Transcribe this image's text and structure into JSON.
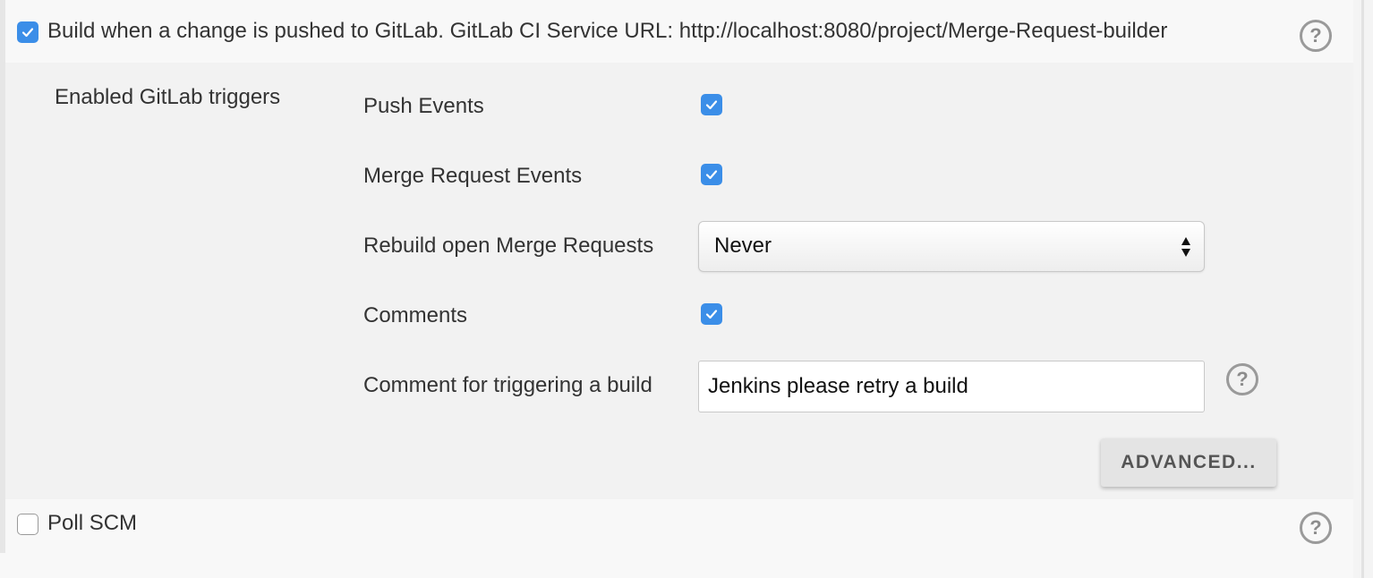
{
  "gitlab_trigger": {
    "checked": true,
    "label": "Build when a change is pushed to GitLab. GitLab CI Service URL: http://localhost:8080/project/Merge-Request-builder",
    "help": "?"
  },
  "triggers_section": {
    "title": "Enabled GitLab triggers",
    "push_events": {
      "label": "Push Events",
      "checked": true
    },
    "merge_request_events": {
      "label": "Merge Request Events",
      "checked": true
    },
    "rebuild_open_mr": {
      "label": "Rebuild open Merge Requests",
      "selected": "Never"
    },
    "comments": {
      "label": "Comments",
      "checked": true
    },
    "comment_trigger": {
      "label": "Comment for triggering a build",
      "value": "Jenkins please retry a build",
      "help": "?"
    },
    "advanced_button": "ADVANCED..."
  },
  "poll_scm": {
    "label": "Poll SCM",
    "checked": false,
    "help": "?"
  },
  "colors": {
    "accent": "#3b8ee8",
    "section_bg": "#f2f2f2",
    "page_bg": "#f8f8f8"
  }
}
